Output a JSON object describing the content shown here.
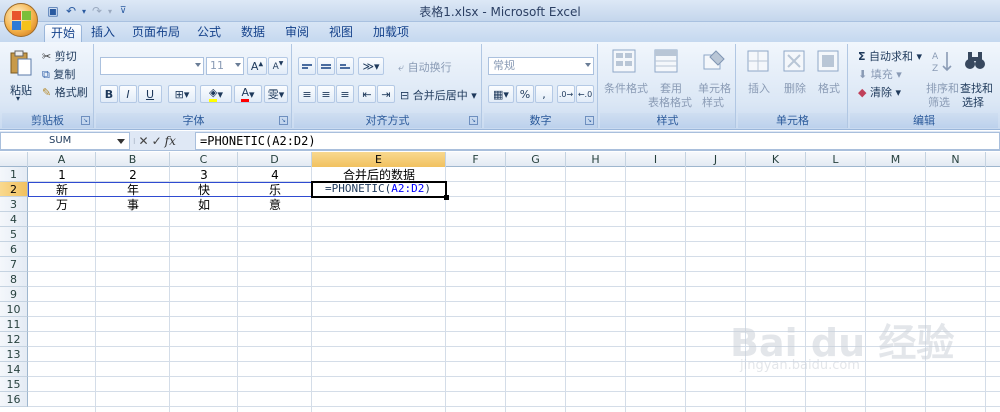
{
  "window": {
    "title": "表格1.xlsx - Microsoft Excel"
  },
  "tabs": [
    "开始",
    "插入",
    "页面布局",
    "公式",
    "数据",
    "审阅",
    "视图",
    "加载项"
  ],
  "ribbon": {
    "clipboard": {
      "label": "剪贴板",
      "paste": "粘贴",
      "cut": "剪切",
      "copy": "复制",
      "format_painter": "格式刷"
    },
    "font": {
      "label": "字体",
      "font_size": "11",
      "bold": "B",
      "italic": "I",
      "underline": "U"
    },
    "alignment": {
      "label": "对齐方式",
      "wrap_text": "自动换行",
      "merge_center": "合并后居中"
    },
    "number": {
      "label": "数字",
      "format": "常规",
      "percent": "%",
      "comma": ","
    },
    "styles": {
      "label": "样式",
      "conditional": "条件格式",
      "table_format_1": "套用",
      "table_format_2": "表格格式",
      "cell_style_1": "单元格",
      "cell_style_2": "样式"
    },
    "cells": {
      "label": "单元格",
      "insert": "插入",
      "delete": "删除",
      "format": "格式"
    },
    "editing": {
      "label": "编辑",
      "autosum": "自动求和",
      "fill": "填充",
      "clear": "清除",
      "sort_1": "排序和",
      "sort_2": "筛选",
      "find_1": "查找和",
      "find_2": "选择"
    }
  },
  "formula_bar": {
    "name_box": "SUM",
    "fx": "fx",
    "formula": "=PHONETIC(A2:D2)"
  },
  "columns": [
    "A",
    "B",
    "C",
    "D",
    "E",
    "F",
    "G",
    "H",
    "I",
    "J",
    "K",
    "L",
    "M",
    "N"
  ],
  "rows": [
    "1",
    "2",
    "3",
    "4",
    "5",
    "6",
    "7",
    "8",
    "9",
    "10",
    "11",
    "12",
    "13",
    "14",
    "15",
    "16"
  ],
  "cells": {
    "A1": "1",
    "B1": "2",
    "C1": "3",
    "D1": "4",
    "E1": "合并后的数据",
    "A2": "新",
    "B2": "年",
    "C2": "快",
    "D2": "乐",
    "A3": "万",
    "B3": "事",
    "C3": "如",
    "D3": "意"
  },
  "active_cell": {
    "prefix": "=PHONETIC(",
    "ref": "A2:D2",
    "suffix": ")"
  },
  "watermark": {
    "text": "Bai du 经验",
    "url": "jingyan.baidu.com"
  },
  "colors": {
    "ribbon": "#dbe7f5",
    "selected_header": "#f1c15f",
    "ref_range": "#2f4bd1"
  }
}
